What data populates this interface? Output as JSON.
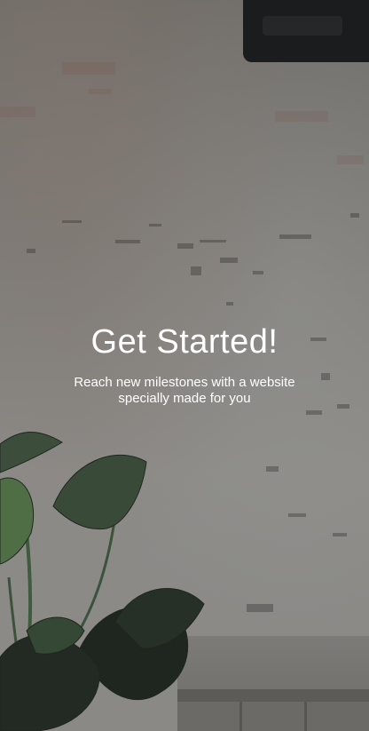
{
  "hero": {
    "title": "Get Started!",
    "subtitle_line1": "Reach new milestones with a  website",
    "subtitle_line2": "specially made for you"
  },
  "colors": {
    "text": "#ffffff",
    "wall": "#7d7c79",
    "plant": "#2f3a2f"
  },
  "icons": {
    "background": "wall-photo",
    "decor": "plant-illustration"
  }
}
